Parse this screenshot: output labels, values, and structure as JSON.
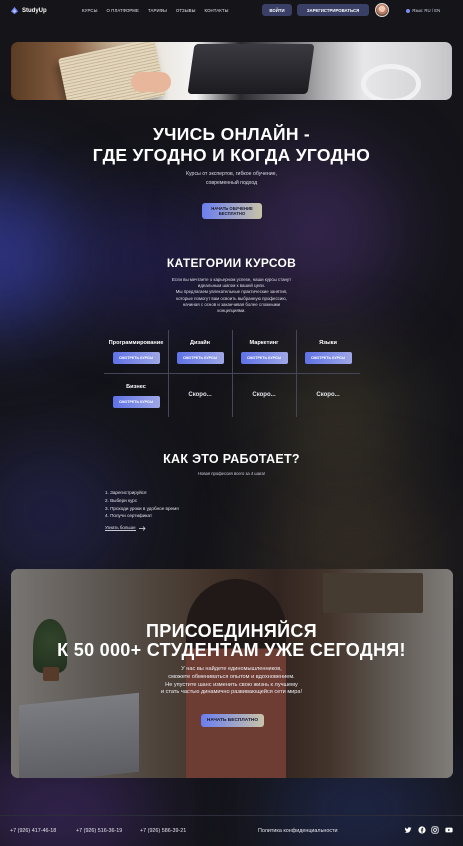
{
  "header": {
    "logo_text": "StudyUp",
    "nav": [
      "КУРСЫ",
      "О ПЛАТФОРМЕ",
      "ТАРИФЫ",
      "ОТЗЫВЫ",
      "КОНТАКТЫ"
    ],
    "login_label": "ВОЙТИ",
    "register_label": "ЗАРЕГИСТРИРОВАТЬСЯ",
    "language": "Язык: RU / EN"
  },
  "hero": {
    "title_line1": "УЧИСЬ ОНЛАЙН -",
    "title_line2": "ГДЕ УГОДНО И КОГДА УГОДНО",
    "subtitle_line1": "Курсы от экспертов, гибкое обучение,",
    "subtitle_line2": "современный подход",
    "cta_line1": "НАЧАТЬ ОБУЧЕНИЕ",
    "cta_line2": "БЕСПЛАТНО"
  },
  "categories": {
    "title": "КАТЕГОРИИ КУРСОВ",
    "description": [
      "Если вы мечтаете о карьерном успехе, наши курсы станут",
      "идеальным шагом к вашей цели.",
      "Мы предлагаем увлекательные практические занятия,",
      "которые помогут вам освоить выбранную профессию,",
      "начиная с основ и заканчивая более сложными",
      "концепциями."
    ],
    "button_label": "СМОТРЕТЬ КУРСЫ",
    "items": [
      {
        "name": "Программирование"
      },
      {
        "name": "Дизайн"
      },
      {
        "name": "Маркетинг"
      },
      {
        "name": "Языки"
      },
      {
        "name": "Бизнес"
      }
    ],
    "soon_label": "Скоро..."
  },
  "how": {
    "title": "КАК ЭТО РАБОТАЕТ?",
    "subtitle": "Новая профессия всего за 4 шага!",
    "steps": [
      "1. Зарегистрируйся",
      "2. Выбери курс",
      "3. Проходи уроки в удобное время",
      "4. Получи сертификат"
    ],
    "more_label": "Узнать больше"
  },
  "join": {
    "title_line1": "ПРИСОЕДИНЯЙСЯ",
    "title_line2": "К 50 000+ СТУДЕНТАМ УЖЕ СЕГОДНЯ!",
    "text": [
      "У нас вы найдете единомышленников,",
      "сможете обмениваться опытом и вдохновением.",
      "Не упустите шанс изменить свою жизнь к лучшему",
      "и стать частью динамично развивающейся сети мира!"
    ],
    "cta_label": "НАЧАТЬ БЕСПЛАТНО"
  },
  "footer": {
    "phones": [
      "+7 (926) 417-46-18",
      "+7 (926) 516-36-19",
      "+7 (926) 586-39-21"
    ],
    "privacy": "Политика конфиденциальности",
    "social_icons": [
      "twitter-icon",
      "facebook-icon",
      "instagram-icon",
      "youtube-icon"
    ]
  }
}
